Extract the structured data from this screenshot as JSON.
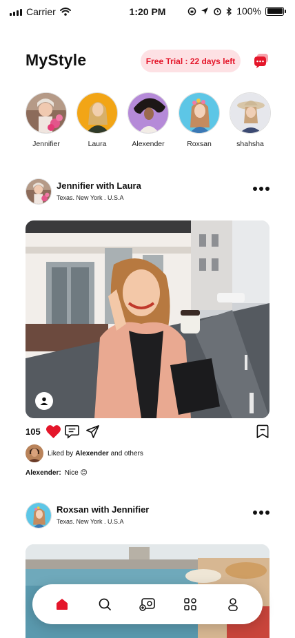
{
  "status_bar": {
    "carrier": "Carrier",
    "time": "1:20 PM",
    "battery": "100%"
  },
  "header": {
    "title": "MyStyle",
    "trial_label": "Free Trial : 22 days left"
  },
  "colors": {
    "accent": "#e4162a",
    "accent_soft": "#fde1e4"
  },
  "stories": [
    {
      "name": "Jennifier"
    },
    {
      "name": "Laura"
    },
    {
      "name": "Alexender"
    },
    {
      "name": "Roxsan"
    },
    {
      "name": "shahsha"
    }
  ],
  "posts": [
    {
      "title": "Jennifier with Laura",
      "location": "Texas. New York . U.S.A",
      "likes": "105",
      "liked_prefix": "Liked by",
      "liked_by": "Alexender",
      "liked_suffix": "and others",
      "comment_author": "Alexender:",
      "comment_text": "Nice 😊"
    },
    {
      "title": "Roxsan with Jennifier",
      "location": "Texas. New York . U.S.A"
    }
  ],
  "nav": [
    {
      "icon": "home-icon",
      "active": true
    },
    {
      "icon": "search-icon",
      "active": false
    },
    {
      "icon": "add-media-icon",
      "active": false
    },
    {
      "icon": "grid-icon",
      "active": false
    },
    {
      "icon": "profile-icon",
      "active": false
    }
  ]
}
